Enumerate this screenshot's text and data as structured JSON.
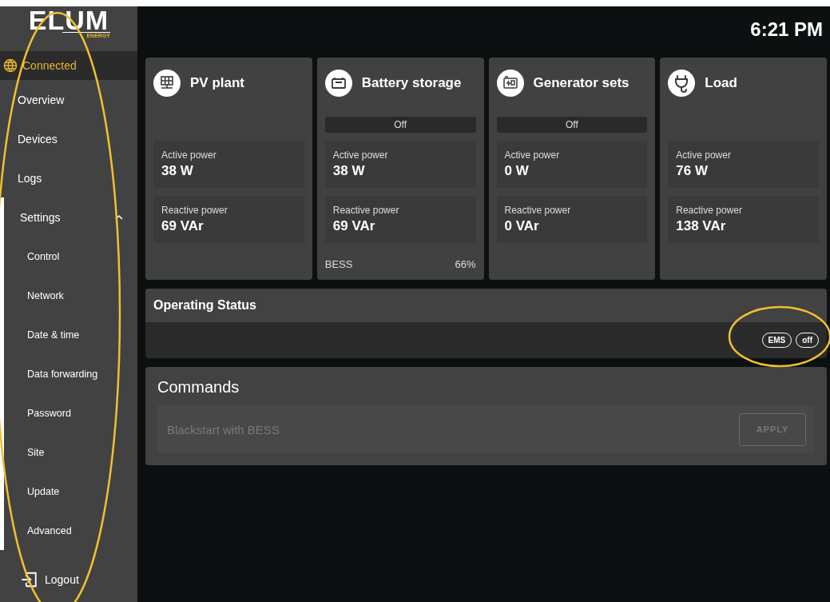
{
  "logo": {
    "text": "ELUM",
    "subtext": "ENERGY"
  },
  "connection": {
    "label": "Connected",
    "connected": true
  },
  "nav": [
    {
      "label": "Overview"
    },
    {
      "label": "Devices"
    },
    {
      "label": "Logs"
    },
    {
      "label": "Settings",
      "expanded": true,
      "children": [
        {
          "label": "Control"
        },
        {
          "label": "Network"
        },
        {
          "label": "Date & time"
        },
        {
          "label": "Data forwarding"
        },
        {
          "label": "Password"
        },
        {
          "label": "Site"
        },
        {
          "label": "Update"
        },
        {
          "label": "Advanced"
        }
      ]
    }
  ],
  "logout": "Logout",
  "clock": "6:21 PM",
  "devices": [
    {
      "kind": "pv",
      "title": "PV plant",
      "metrics": [
        {
          "label": "Active power",
          "value": "38 W"
        },
        {
          "label": "Reactive power",
          "value": "69 VAr"
        }
      ]
    },
    {
      "kind": "battery",
      "title": "Battery storage",
      "status": "Off",
      "metrics": [
        {
          "label": "Active power",
          "value": "38 W"
        },
        {
          "label": "Reactive power",
          "value": "69 VAr"
        }
      ],
      "footer": {
        "label": "BESS",
        "value": "66%"
      }
    },
    {
      "kind": "generator",
      "title": "Generator sets",
      "status": "Off",
      "metrics": [
        {
          "label": "Active power",
          "value": "0 W"
        },
        {
          "label": "Reactive power",
          "value": "0 VAr"
        }
      ]
    },
    {
      "kind": "load",
      "title": "Load",
      "metrics": [
        {
          "label": "Active power",
          "value": "76 W"
        },
        {
          "label": "Reactive power",
          "value": "138 VAr"
        }
      ]
    }
  ],
  "operating_status": {
    "title": "Operating Status",
    "badges": [
      "EMS",
      "off"
    ]
  },
  "commands": {
    "title": "Commands",
    "field": {
      "placeholder": "Blackstart with BESS",
      "disabled": true
    },
    "apply": {
      "label": "APPLY",
      "disabled": true
    }
  }
}
